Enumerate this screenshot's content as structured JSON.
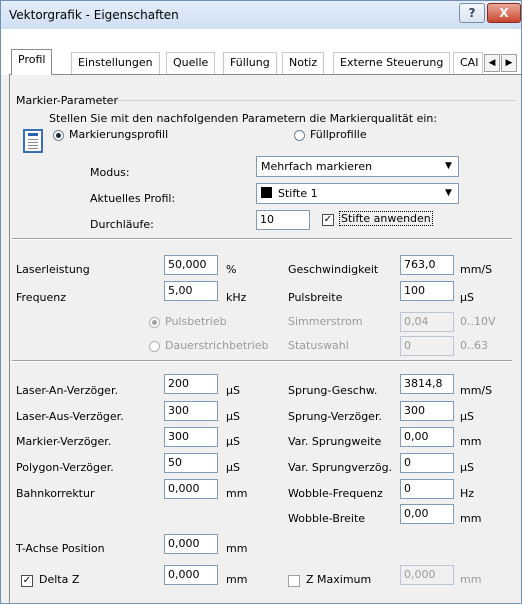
{
  "window": {
    "title": "Vektorgrafik - Eigenschaften",
    "help_label": "?",
    "close_label": "X"
  },
  "tabs": [
    "Profil",
    "Einstellungen",
    "Quelle",
    "Füllung",
    "Notiz",
    "Externe Steuerung",
    "CAI"
  ],
  "markier": {
    "group_title": "Markier-Parameter",
    "instruction": "Stellen Sie mit den nachfolgenden Parametern die Markierqualität ein:",
    "radio_profil": "Markierungsprofill",
    "radio_fuell": "Füllprofille",
    "modus_label": "Modus:",
    "modus_value": "Mehrfach markieren",
    "profil_label": "Aktuelles Profil:",
    "profil_value": "Stifte 1",
    "durchlaeufe_label": "Durchläufe:",
    "durchlaeufe_value": "10",
    "stifte_label": "Stifte anwenden"
  },
  "laser": {
    "leistung_label": "Laserleistung",
    "leistung_value": "50,000",
    "leistung_unit": "%",
    "frequenz_label": "Frequenz",
    "frequenz_value": "5,00",
    "frequenz_unit": "kHz",
    "geschw_label": "Geschwindigkeit",
    "geschw_value": "763,0",
    "geschw_unit": "mm/S",
    "pulsbreite_label": "Pulsbreite",
    "pulsbreite_value": "100",
    "pulsbreite_unit": "µS",
    "pulsbetrieb_label": "Pulsbetrieb",
    "dauer_label": "Dauerstrichbetrieb",
    "simmer_label": "Simmerstrom",
    "simmer_value": "0,04",
    "simmer_range": "0..10V",
    "status_label": "Statuswahl",
    "status_value": "0",
    "status_range": "0..63"
  },
  "delays": {
    "an_label": "Laser-An-Verzöger.",
    "an_value": "200",
    "an_unit": "µS",
    "aus_label": "Laser-Aus-Verzöger.",
    "aus_value": "300",
    "aus_unit": "µS",
    "markier_label": "Markier-Verzöger.",
    "markier_value": "300",
    "markier_unit": "µS",
    "polygon_label": "Polygon-Verzöger.",
    "polygon_value": "50",
    "polygon_unit": "µS",
    "bahn_label": "Bahnkorrektur",
    "bahn_value": "0,000",
    "bahn_unit": "mm",
    "sprung_g_label": "Sprung-Geschw.",
    "sprung_g_value": "3814,8",
    "sprung_g_unit": "mm/S",
    "sprung_v_label": "Sprung-Verzöger.",
    "sprung_v_value": "300",
    "sprung_v_unit": "µS",
    "var_w_label": "Var. Sprungweite",
    "var_w_value": "0,00",
    "var_w_unit": "mm",
    "var_v_label": "Var. Sprungverzög.",
    "var_v_value": "0",
    "var_v_unit": "µS",
    "wob_f_label": "Wobble-Frequenz",
    "wob_f_value": "0",
    "wob_f_unit": "Hz",
    "wob_b_label": "Wobble-Breite",
    "wob_b_value": "0,00",
    "wob_b_unit": "mm"
  },
  "taxis": {
    "label": "T-Achse Position",
    "value": "0,000",
    "unit": "mm",
    "deltaz_label": "Delta Z",
    "deltaz_value": "0,000",
    "deltaz_unit": "mm",
    "zmax_label": "Z Maximum",
    "zmax_value": "0,000",
    "zmax_unit": "mm"
  }
}
